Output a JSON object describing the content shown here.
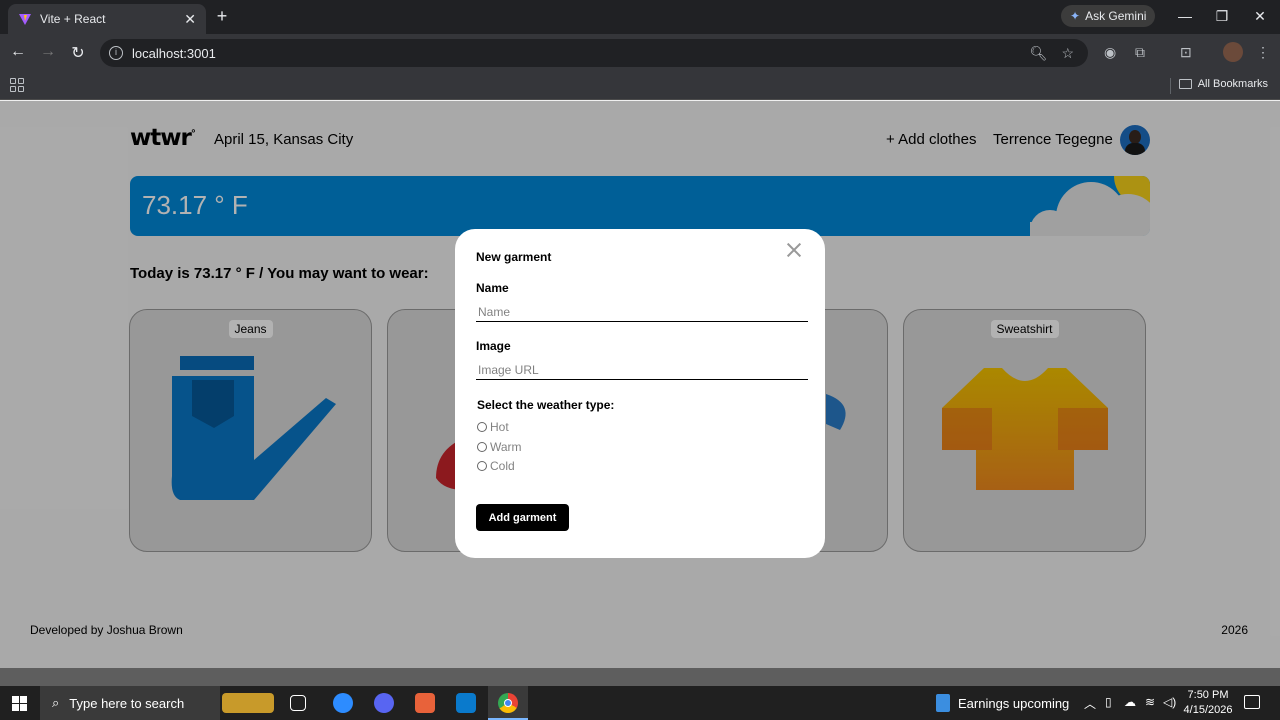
{
  "browser": {
    "tab_title": "Vite + React",
    "url": "localhost:3001",
    "ask_gemini": "Ask Gemini",
    "all_bookmarks": "All Bookmarks"
  },
  "header": {
    "logo": "wtwr",
    "logo_mark": "°",
    "date_location": "April 15, Kansas City",
    "add_clothes": "+ Add clothes",
    "username": "Terrence Tegegne"
  },
  "weather": {
    "temperature": "73.17 ° F"
  },
  "main": {
    "today_text": "Today is 73.17 ° F / You may want to wear:",
    "cards": [
      {
        "label": "Jeans"
      },
      {
        "label": "Sweatshirt"
      }
    ]
  },
  "modal": {
    "title": "New garment",
    "name_label": "Name",
    "name_placeholder": "Name",
    "image_label": "Image",
    "image_placeholder": "Image URL",
    "weather_label": "Select the weather type:",
    "options": [
      "Hot",
      "Warm",
      "Cold"
    ],
    "submit_label": "Add garment"
  },
  "footer": {
    "developer": "Developed by Joshua Brown",
    "year": "2026"
  },
  "taskbar": {
    "search_placeholder": "Type here to search",
    "news": "Earnings upcoming",
    "time": "7:50 PM",
    "date": "4/15/2026"
  },
  "colors": {
    "weather_bar": "#0088d9",
    "sun": "#f7d21a",
    "jeans": "#0a78c8",
    "sweatshirt": "#f1b21a"
  }
}
